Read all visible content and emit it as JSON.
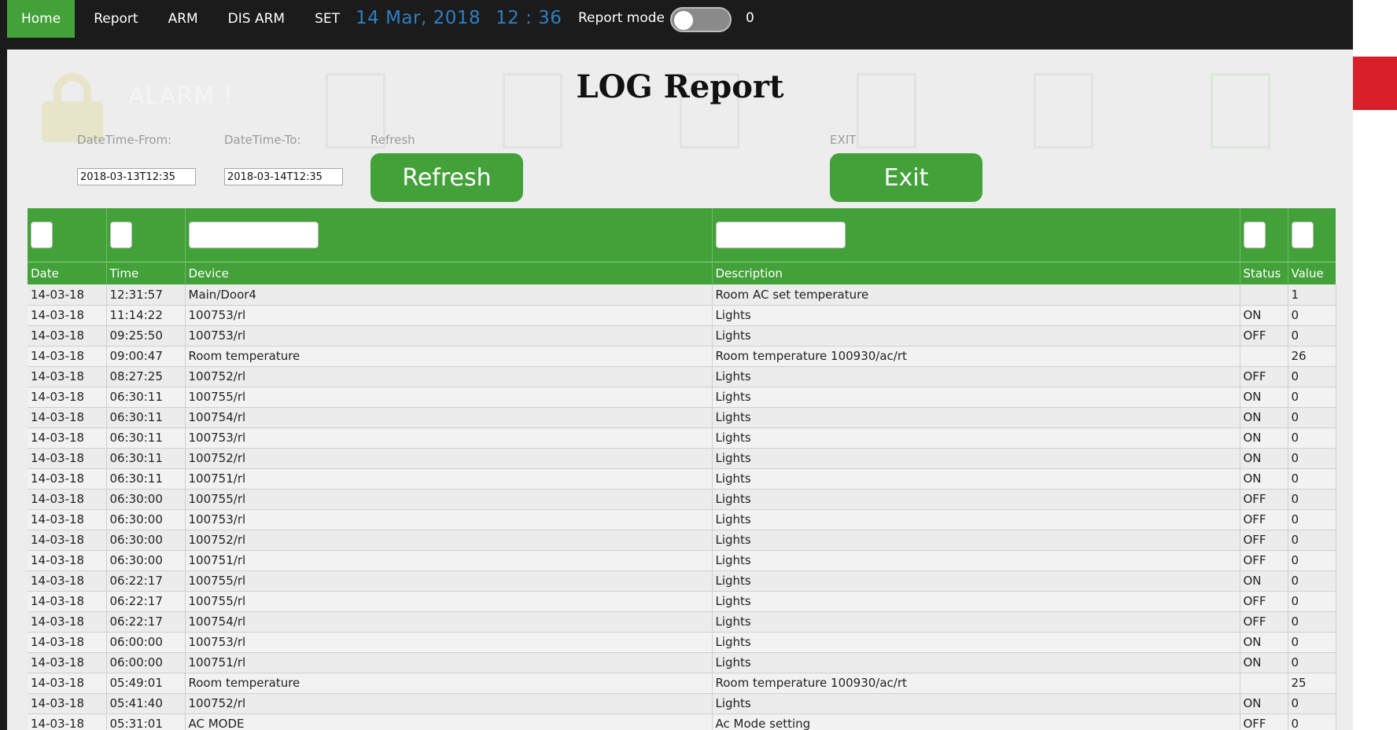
{
  "nav": {
    "items": [
      {
        "label": "Home",
        "active": true
      },
      {
        "label": "Report",
        "active": false
      },
      {
        "label": "ARM",
        "active": false
      },
      {
        "label": "DIS ARM",
        "active": false
      },
      {
        "label": "SET",
        "active": false
      }
    ],
    "date": "14 Mar, 2018",
    "time": "12 : 36",
    "report_mode_label": "Report mode",
    "report_mode_count": "0"
  },
  "background": {
    "alarm_text": "ALARM !"
  },
  "report": {
    "title": "LOG Report",
    "from_label": "DateTime-From:",
    "to_label": "DateTime-To:",
    "refresh_label_small": "Refresh",
    "exit_label_small": "EXIT",
    "from_value": "2018-03-13T12:35",
    "to_value": "2018-03-14T12:35",
    "refresh_button": "Refresh",
    "exit_button": "Exit"
  },
  "table": {
    "columns": [
      "Date",
      "Time",
      "Device",
      "Description",
      "Status",
      "Value"
    ],
    "rows": [
      [
        "14-03-18",
        "12:31:57",
        "Main/Door4",
        "Room AC set temperature",
        "",
        "1"
      ],
      [
        "14-03-18",
        "11:14:22",
        "100753/rl",
        "Lights",
        "ON",
        "0"
      ],
      [
        "14-03-18",
        "09:25:50",
        "100753/rl",
        "Lights",
        "OFF",
        "0"
      ],
      [
        "14-03-18",
        "09:00:47",
        "Room temperature",
        "Room temperature 100930/ac/rt",
        "",
        "26"
      ],
      [
        "14-03-18",
        "08:27:25",
        "100752/rl",
        "Lights",
        "OFF",
        "0"
      ],
      [
        "14-03-18",
        "06:30:11",
        "100755/rl",
        "Lights",
        "ON",
        "0"
      ],
      [
        "14-03-18",
        "06:30:11",
        "100754/rl",
        "Lights",
        "ON",
        "0"
      ],
      [
        "14-03-18",
        "06:30:11",
        "100753/rl",
        "Lights",
        "ON",
        "0"
      ],
      [
        "14-03-18",
        "06:30:11",
        "100752/rl",
        "Lights",
        "ON",
        "0"
      ],
      [
        "14-03-18",
        "06:30:11",
        "100751/rl",
        "Lights",
        "ON",
        "0"
      ],
      [
        "14-03-18",
        "06:30:00",
        "100755/rl",
        "Lights",
        "OFF",
        "0"
      ],
      [
        "14-03-18",
        "06:30:00",
        "100753/rl",
        "Lights",
        "OFF",
        "0"
      ],
      [
        "14-03-18",
        "06:30:00",
        "100752/rl",
        "Lights",
        "OFF",
        "0"
      ],
      [
        "14-03-18",
        "06:30:00",
        "100751/rl",
        "Lights",
        "OFF",
        "0"
      ],
      [
        "14-03-18",
        "06:22:17",
        "100755/rl",
        "Lights",
        "ON",
        "0"
      ],
      [
        "14-03-18",
        "06:22:17",
        "100755/rl",
        "Lights",
        "OFF",
        "0"
      ],
      [
        "14-03-18",
        "06:22:17",
        "100754/rl",
        "Lights",
        "OFF",
        "0"
      ],
      [
        "14-03-18",
        "06:00:00",
        "100753/rl",
        "Lights",
        "ON",
        "0"
      ],
      [
        "14-03-18",
        "06:00:00",
        "100751/rl",
        "Lights",
        "ON",
        "0"
      ],
      [
        "14-03-18",
        "05:49:01",
        "Room temperature",
        "Room temperature 100930/ac/rt",
        "",
        "25"
      ],
      [
        "14-03-18",
        "05:41:40",
        "100752/rl",
        "Lights",
        "ON",
        "0"
      ],
      [
        "14-03-18",
        "05:31:01",
        "AC MODE",
        "Ac Mode setting",
        "OFF",
        "0"
      ]
    ]
  }
}
